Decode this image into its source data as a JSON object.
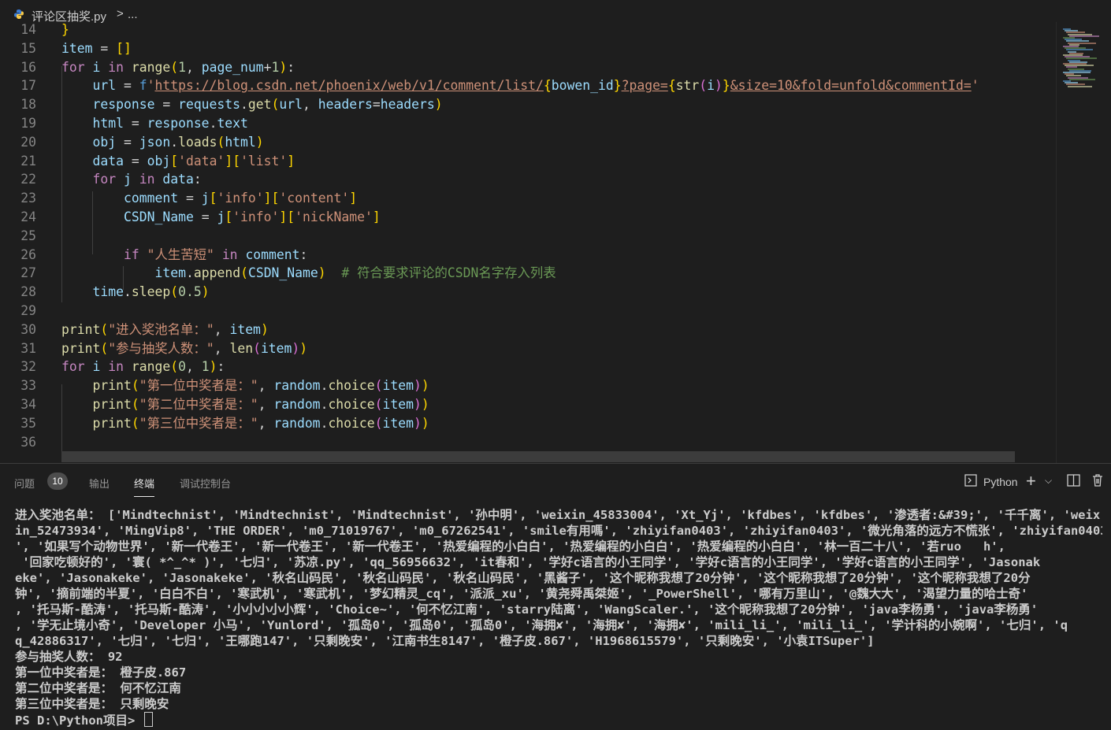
{
  "breadcrumb": {
    "file": "评论区抽奖.py",
    "separator": ">",
    "more": "..."
  },
  "editor": {
    "line_numbers": [
      "14",
      "15",
      "16",
      "17",
      "18",
      "19",
      "20",
      "21",
      "22",
      "23",
      "24",
      "25",
      "26",
      "27",
      "28",
      "29",
      "30",
      "31",
      "32",
      "33",
      "34",
      "35",
      "36"
    ],
    "lines": [
      "}",
      "item = []",
      "for i in range(1, page_num+1):",
      "    url = f'https://blog.csdn.net/phoenix/web/v1/comment/list/{bowen_id}?page={str(i)}&size=10&fold=unfold&commentId='",
      "    response = requests.get(url, headers=headers)",
      "    html = response.text",
      "    obj = json.loads(html)",
      "    data = obj['data']['list']",
      "    for j in data:",
      "        comment = j['info']['content']",
      "        CSDN_Name = j['info']['nickName']",
      "",
      "        if \"人生苦短\" in comment:",
      "            item.append(CSDN_Name)  # 符合要求评论的CSDN名字存入列表",
      "    time.sleep(0.5)",
      "",
      "print(\"进入奖池名单：\", item)",
      "print(\"参与抽奖人数：\", len(item))",
      "for i in range(0, 1):",
      "    print(\"第一位中奖者是：\", random.choice(item))",
      "    print(\"第二位中奖者是：\", random.choice(item))",
      "    print(\"第三位中奖者是：\", random.choice(item))",
      ""
    ]
  },
  "panel": {
    "tabs": [
      "问题",
      "输出",
      "终端",
      "调试控制台"
    ],
    "problems_count": "10",
    "terminal_type": "Python",
    "terminal_lines": [
      "进入奖池名单： ['Mindtechnist', 'Mindtechnist', 'Mindtechnist', '孙中明', 'weixin_45833004', 'Xt_Yj', 'kfdbes', 'kfdbes', '渗透者:&#39;', '千千离', 'weix",
      "in_52473934', 'MingVip8', 'THE ORDER', 'm0_71019767', 'm0_67262541', 'smile有用嗎', 'zhiyifan0403', 'zhiyifan0403', '微光角落的远方不慌张', 'zhiyifan0403",
      "', '如果写个动物世界', '新一代卷王', '新一代卷王', '新一代卷王', '热爱编程的小白白', '热爱编程的小白白', '热爱编程的小白白', '林一百二十八', '若ruo   h',",
      " '回家吃顿好的', '寰( *^_^* )', '七归', '苏凉.py', 'qq_56956632', 'it春和', '学好c语言的小王同学', '学好c语言的小王同学', '学好c语言的小王同学', 'Jasonak",
      "eke', 'Jasonakeke', 'Jasonakeke', '秋名山码民', '秋名山码民', '秋名山码民', '黑酱子', '这个昵称我想了20分钟', '这个昵称我想了20分钟', '这个昵称我想了20分",
      "钟', '摘前端的半夏', '白白不白', '寒武机', '寒武机', '梦幻精灵_cq', '派派_xu', '黄尧舜禹桀姬', '_PowerShell', '哪有万里山', '@魏大大', '渴望力量的哈士奇'",
      ", '托马斯-酷涛', '托马斯-酷涛', '小小小小小辉', 'Choice~', '何不忆江南', 'starry陆离', 'WangScaler.', '这个昵称我想了20分钟', 'java李杨勇', 'java李杨勇'",
      ", '学无止境小奇', 'Developer 小马', 'Yunlord', '孤岛0', '孤岛0', '孤岛0', '海拥✘', '海拥✘', '海拥✘', 'mili_li_', 'mili_li_', '学计科的小婉啊', '七归', 'q",
      "q_42886317', '七归', '七归', '王哪跑147', '只剩晚安', '江南书生8147', '橙子皮.867', 'H1968615579', '只剩晚安', '小袁ITSuper']",
      "参与抽奖人数： 92",
      "第一位中奖者是： 橙子皮.867",
      "第二位中奖者是： 何不忆江南",
      "第三位中奖者是： 只剩晚安"
    ],
    "prompt": "PS D:\\Python项目> "
  },
  "colors": {
    "background": "#1e1e1e",
    "keyword": "#569cd6",
    "string": "#ce9178",
    "comment": "#6a9955"
  }
}
